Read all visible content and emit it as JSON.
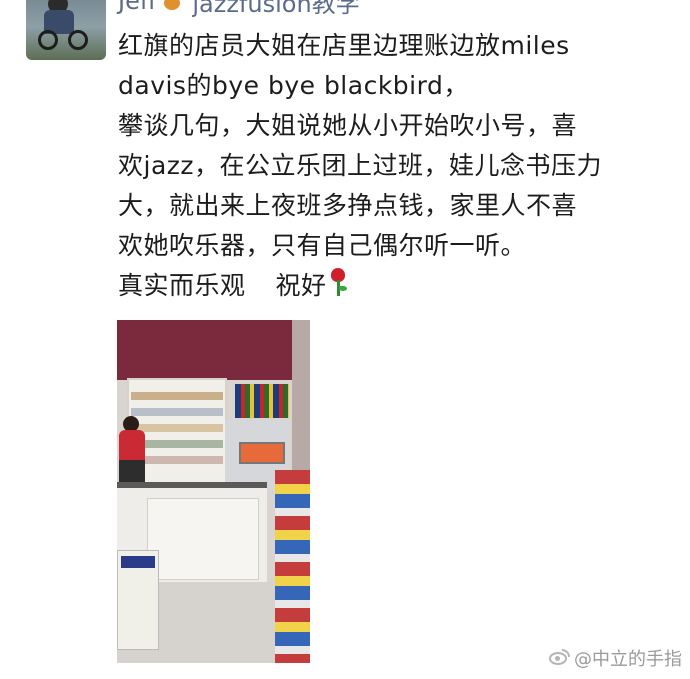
{
  "post": {
    "author_name": "Jeff",
    "author_tag": "jazzfusion教学",
    "lines": [
      "红旗的店员大姐在店里边理账边放miles",
      "davis的bye bye blackbird，",
      "攀谈几句，大姐说她从小开始吹小号，喜",
      "欢jazz，在公立乐团上过班，娃儿念书压力",
      "大，就出来上夜班多挣点钱，家里人不喜",
      "欢她吹乐器，只有自己偶尔听一听。"
    ],
    "last_line_a": "真实而乐观",
    "last_line_b": "祝好"
  },
  "watermark": {
    "text": "@中立的手指"
  },
  "icons": {
    "author_badge": "guitar-icon",
    "emoji": "rose-icon",
    "watermark": "weibo-icon"
  }
}
